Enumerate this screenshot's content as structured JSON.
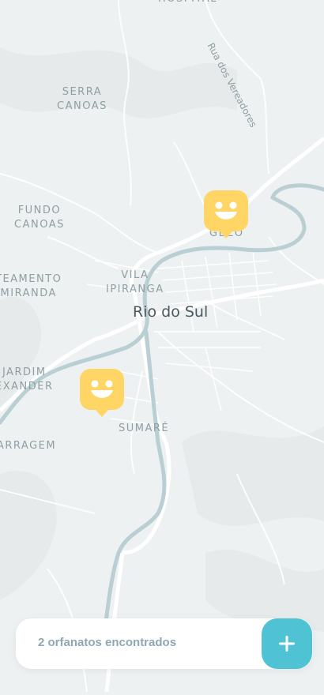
{
  "map": {
    "city_label": "Rio do Sul",
    "street_label": "Rua dos Vereadores",
    "places": [
      {
        "name": "SERRA\nCANOAS"
      },
      {
        "name": "FUNDO\nCANOAS"
      },
      {
        "name": "VILA\nIPIRANGA"
      },
      {
        "name": "GEZO"
      },
      {
        "name": "TEAMENTO\nMIRANDA"
      },
      {
        "name": "JARDIM\nEXANDER"
      },
      {
        "name": "SUMARÉ"
      },
      {
        "name": "ARRAGEM"
      },
      {
        "name": "HOSPITAL"
      }
    ],
    "markers": [
      {
        "icon": "smile-marker-icon",
        "color": "#ffd666"
      },
      {
        "icon": "smile-marker-icon",
        "color": "#ffd666"
      }
    ]
  },
  "footer": {
    "count_text": "2 orfanatos encontrados",
    "add_button_icon": "plus-icon",
    "accent_color": "#4fc3d4"
  }
}
